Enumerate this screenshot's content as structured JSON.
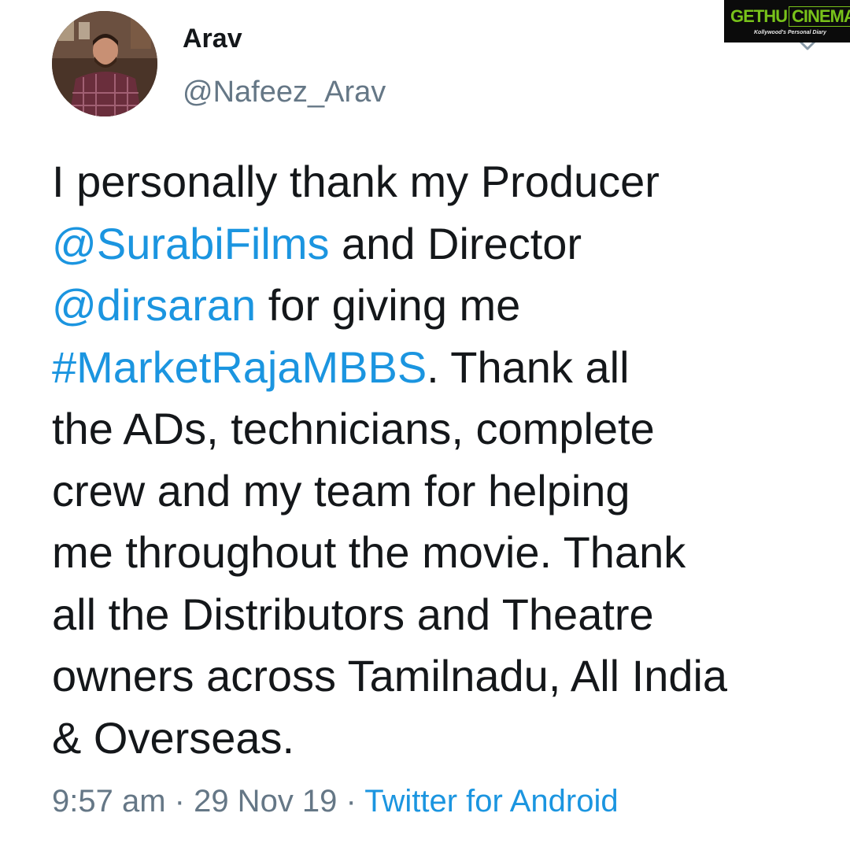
{
  "tweet": {
    "author": {
      "display_name": "Arav",
      "handle": "@Nafeez_Arav",
      "avatar_icon": "profile-photo"
    },
    "menu_icon": "chevron-down-icon",
    "body_lines": [
      [
        {
          "text": "I personally thank my Producer",
          "type": "text"
        }
      ],
      [
        {
          "text": "@SurabiFilms",
          "type": "mention"
        },
        {
          "text": " and Director",
          "type": "text"
        }
      ],
      [
        {
          "text": "@dirsaran",
          "type": "mention"
        },
        {
          "text": " for giving me",
          "type": "text"
        }
      ],
      [
        {
          "text": "#MarketRajaMBBS",
          "type": "hashtag"
        },
        {
          "text": ". Thank all",
          "type": "text"
        }
      ],
      [
        {
          "text": "the ADs, technicians, complete",
          "type": "text"
        }
      ],
      [
        {
          "text": "crew and my team for helping",
          "type": "text"
        }
      ],
      [
        {
          "text": "me throughout the movie. Thank",
          "type": "text"
        }
      ],
      [
        {
          "text": "all the Distributors and Theatre",
          "type": "text"
        }
      ],
      [
        {
          "text": "owners across Tamilnadu, All India",
          "type": "text"
        }
      ],
      [
        {
          "text": "& Overseas.",
          "type": "text"
        }
      ]
    ],
    "meta": {
      "time": "9:57 am",
      "separator": " · ",
      "date": "29 Nov 19",
      "source": "Twitter for Android"
    }
  },
  "watermark": {
    "word1": "GETHU",
    "word2": "CINEMA",
    "tagline": "Kollywood's Personal Diary"
  },
  "colors": {
    "text": "#14171a",
    "secondary": "#657786",
    "link": "#1b95e0",
    "watermark_green": "#78c21a"
  }
}
